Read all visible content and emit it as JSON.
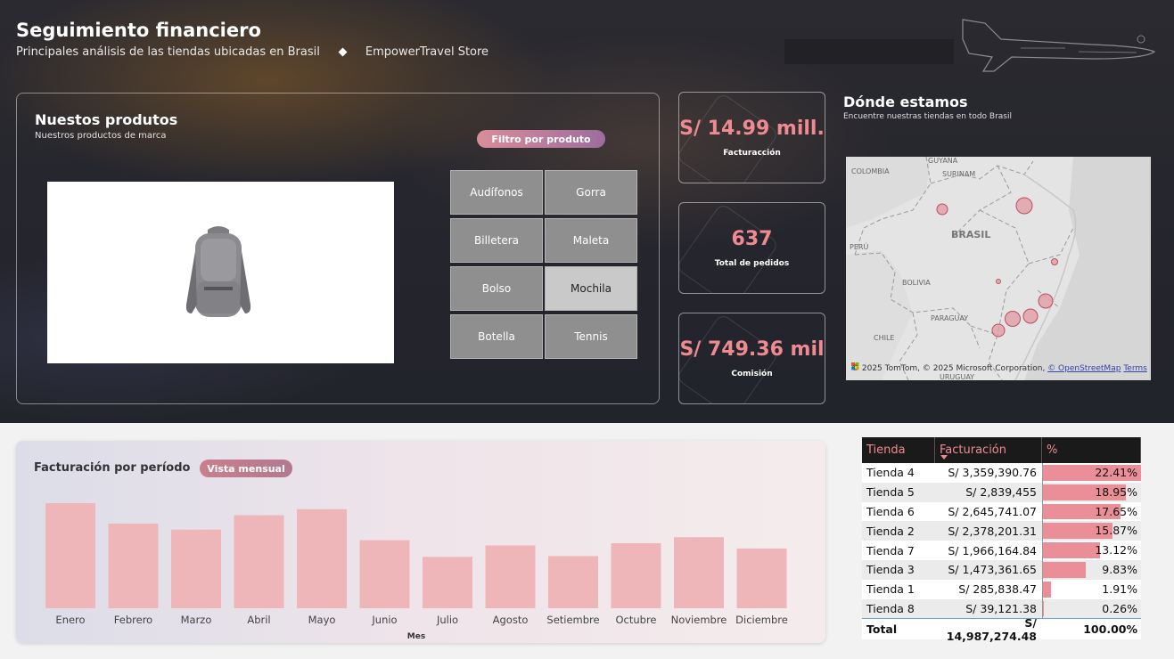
{
  "header": {
    "title": "Seguimiento financiero",
    "subtitle": "Principales análisis de las tiendas ubicadas en Brasil",
    "store": "EmpowerTravel Store"
  },
  "products": {
    "title": "Nuestos produtos",
    "subtitle": "Nuestros productos de marca",
    "filter_label": "Filtro por produto",
    "buttons": [
      "Audífonos",
      "Gorra",
      "Billetera",
      "Maleta",
      "Bolso",
      "Mochila",
      "Botella",
      "Tennis"
    ],
    "selected": "Mochila"
  },
  "kpis": [
    {
      "value": "S/ 14.99 mill.",
      "label": "Facturacción"
    },
    {
      "value": "637",
      "label": "Total de pedidos"
    },
    {
      "value": "S/ 749.36 mil",
      "label": "Comisión"
    }
  ],
  "map": {
    "title": "Dónde estamos",
    "subtitle": "Encuentre nuestras tiendas en todo Brasil",
    "labels": {
      "colombia": "COLOMBIA",
      "guyana": "GUYANA",
      "surinam": "SURINAM",
      "brasil": "BRASIL",
      "peru": "PERÚ",
      "bolivia": "BOLIVIA",
      "paraguay": "PARAGUAY",
      "chile": "CHILE",
      "uruguay": "URUGUAY"
    },
    "credit": "© 2025 TomTom, © 2025 Microsoft Corporation,",
    "osm": "© OpenStreetMap",
    "terms": "Terms"
  },
  "period": {
    "title": "Facturación por período",
    "view_label": "Vista mensual"
  },
  "chart_data": {
    "type": "bar",
    "categories": [
      "Enero",
      "Febrero",
      "Marzo",
      "Abril",
      "Mayo",
      "Junio",
      "Julio",
      "Agosto",
      "Setiembre",
      "Octubre",
      "Noviembre",
      "Diciembre"
    ],
    "values": [
      1.39,
      1.12,
      1.04,
      1.23,
      1.31,
      0.9,
      0.68,
      0.83,
      0.69,
      0.86,
      0.94,
      0.79
    ],
    "xlabel": "Mes",
    "ylabel": "",
    "color": "#efb6ba"
  },
  "table": {
    "headers": [
      "Tienda",
      "Facturación",
      "%"
    ],
    "rows": [
      {
        "store": "Tienda 4",
        "billing": "S/ 3,359,390.76",
        "pct": "22.41%",
        "share": 22.41
      },
      {
        "store": "Tienda 5",
        "billing": "S/ 2,839,455",
        "pct": "18.95%",
        "share": 18.95
      },
      {
        "store": "Tienda 6",
        "billing": "S/ 2,645,741.07",
        "pct": "17.65%",
        "share": 17.65
      },
      {
        "store": "Tienda 2",
        "billing": "S/ 2,378,201.31",
        "pct": "15.87%",
        "share": 15.87
      },
      {
        "store": "Tienda 7",
        "billing": "S/ 1,966,164.84",
        "pct": "13.12%",
        "share": 13.12
      },
      {
        "store": "Tienda 3",
        "billing": "S/ 1,473,361.65",
        "pct": "9.83%",
        "share": 9.83
      },
      {
        "store": "Tienda 1",
        "billing": "S/ 285,838.47",
        "pct": "1.91%",
        "share": 1.91
      },
      {
        "store": "Tienda 8",
        "billing": "S/ 39,121.38",
        "pct": "0.26%",
        "share": 0.26
      }
    ],
    "total": {
      "label": "Total",
      "billing": "S/ 14,987,274.48",
      "pct": "100.00%"
    }
  }
}
